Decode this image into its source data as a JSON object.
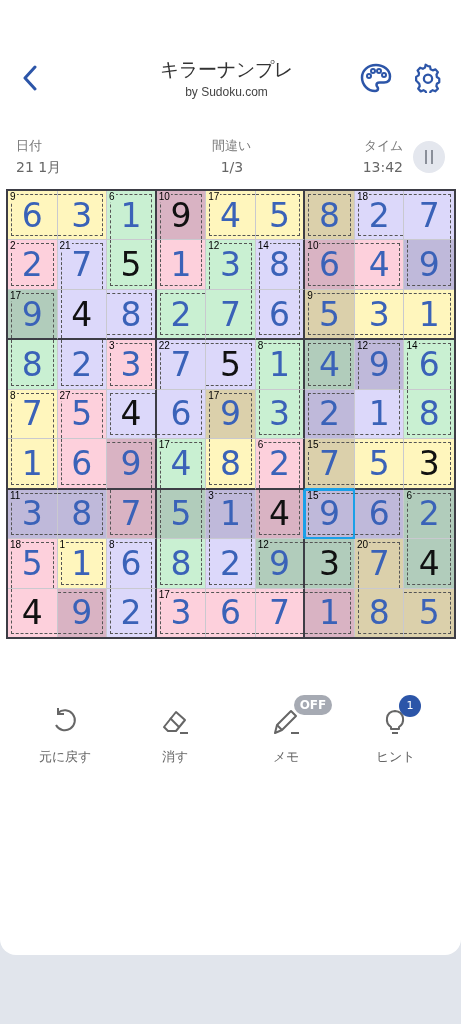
{
  "header": {
    "title": "キラーナンプレ",
    "subtitle": "by Sudoku.com"
  },
  "stats": [
    {
      "label": "日付",
      "value": "21 1月"
    },
    {
      "label": "間違い",
      "value": "1/3"
    },
    {
      "label": "タイム",
      "value": "13:42"
    }
  ],
  "grid": [
    [
      {
        "value": "6",
        "given": false,
        "sum": "9",
        "color": "#fff6bd",
        "cage_edges": [
          true,
          false,
          true,
          true
        ],
        "selected": false
      },
      {
        "value": "3",
        "given": false,
        "color": "#fff6bd",
        "cage_edges": [
          true,
          true,
          true,
          false
        ],
        "selected": false
      },
      {
        "value": "1",
        "given": false,
        "sum": "6",
        "color": "#c9f0d2",
        "cage_edges": [
          true,
          true,
          false,
          true
        ],
        "selected": false
      },
      {
        "value": "9",
        "given": true,
        "sum": "10",
        "color": "#d9b3c3",
        "cage_edges": [
          true,
          true,
          false,
          true
        ],
        "selected": false
      },
      {
        "value": "4",
        "given": false,
        "sum": "17",
        "color": "#fff6bd",
        "cage_edges": [
          true,
          false,
          true,
          true
        ],
        "selected": false
      },
      {
        "value": "5",
        "given": false,
        "color": "#fff6bd",
        "cage_edges": [
          true,
          true,
          true,
          false
        ],
        "selected": false
      },
      {
        "value": "8",
        "given": false,
        "color": "#dbd0ab",
        "cage_edges": [
          true,
          true,
          true,
          true
        ],
        "selected": false
      },
      {
        "value": "2",
        "given": false,
        "sum": "18",
        "color": "#dcd8fa",
        "cage_edges": [
          true,
          false,
          true,
          true
        ],
        "selected": false
      },
      {
        "value": "7",
        "given": false,
        "color": "#dcd8fa",
        "cage_edges": [
          true,
          true,
          false,
          false
        ],
        "selected": false
      }
    ],
    [
      {
        "value": "2",
        "given": false,
        "sum": "2",
        "color": "#fdd0dc",
        "cage_edges": [
          true,
          true,
          true,
          true
        ],
        "selected": false
      },
      {
        "value": "7",
        "given": false,
        "sum": "21",
        "color": "#dcd8fa",
        "cage_edges": [
          true,
          true,
          false,
          true
        ],
        "selected": false
      },
      {
        "value": "5",
        "given": true,
        "color": "#c9f0d2",
        "cage_edges": [
          false,
          true,
          true,
          true
        ],
        "selected": false
      },
      {
        "value": "1",
        "given": false,
        "color": "#fdd0dc",
        "cage_edges": [
          false,
          true,
          true,
          true
        ],
        "selected": false
      },
      {
        "value": "3",
        "given": false,
        "sum": "12",
        "color": "#c9f0d2",
        "cage_edges": [
          true,
          true,
          false,
          true
        ],
        "selected": false
      },
      {
        "value": "8",
        "given": false,
        "sum": "14",
        "color": "#dcd8fa",
        "cage_edges": [
          true,
          true,
          false,
          true
        ],
        "selected": false
      },
      {
        "value": "6",
        "given": false,
        "sum": "10",
        "color": "#d9b3c3",
        "cage_edges": [
          true,
          false,
          true,
          true
        ],
        "selected": false
      },
      {
        "value": "4",
        "given": false,
        "color": "#fdd0dc",
        "cage_edges": [
          true,
          true,
          true,
          false
        ],
        "selected": false
      },
      {
        "value": "9",
        "given": false,
        "color": "#bfb9da",
        "cage_edges": [
          false,
          true,
          true,
          true
        ],
        "selected": false
      }
    ],
    [
      {
        "value": "9",
        "given": false,
        "sum": "17",
        "color": "#b1ccbb",
        "cage_edges": [
          true,
          true,
          false,
          true
        ],
        "selected": false
      },
      {
        "value": "4",
        "given": true,
        "color": "#dcd8fa",
        "cage_edges": [
          false,
          false,
          false,
          true
        ],
        "selected": false
      },
      {
        "value": "8",
        "given": false,
        "color": "#dcd8fa",
        "cage_edges": [
          true,
          true,
          true,
          false
        ],
        "selected": false
      },
      {
        "value": "2",
        "given": false,
        "color": "#c9f0d2",
        "cage_edges": [
          true,
          false,
          true,
          true
        ],
        "selected": false
      },
      {
        "value": "7",
        "given": false,
        "color": "#c9f0d2",
        "cage_edges": [
          false,
          true,
          true,
          false
        ],
        "selected": false
      },
      {
        "value": "6",
        "given": false,
        "color": "#dcd8fa",
        "cage_edges": [
          false,
          true,
          true,
          true
        ],
        "selected": false
      },
      {
        "value": "5",
        "given": false,
        "sum": "9",
        "color": "#dbd0ab",
        "cage_edges": [
          true,
          false,
          true,
          true
        ],
        "selected": false
      },
      {
        "value": "3",
        "given": false,
        "color": "#fff6bd",
        "cage_edges": [
          true,
          false,
          true,
          false
        ],
        "selected": false
      },
      {
        "value": "1",
        "given": false,
        "color": "#fff6bd",
        "cage_edges": [
          true,
          true,
          true,
          false
        ],
        "selected": false
      }
    ],
    [
      {
        "value": "8",
        "given": false,
        "color": "#c9f0d2",
        "cage_edges": [
          false,
          true,
          true,
          true
        ],
        "selected": false
      },
      {
        "value": "2",
        "given": false,
        "color": "#dcd8fa",
        "cage_edges": [
          false,
          true,
          true,
          true
        ],
        "selected": false
      },
      {
        "value": "3",
        "given": false,
        "sum": "3",
        "color": "#fdd0dc",
        "cage_edges": [
          true,
          true,
          true,
          true
        ],
        "selected": false
      },
      {
        "value": "7",
        "given": false,
        "sum": "22",
        "color": "#dcd8fa",
        "cage_edges": [
          true,
          false,
          false,
          true
        ],
        "selected": false
      },
      {
        "value": "5",
        "given": true,
        "color": "#dcd8fa",
        "cage_edges": [
          true,
          true,
          true,
          false
        ],
        "selected": false
      },
      {
        "value": "1",
        "given": false,
        "sum": "8",
        "color": "#c9f0d2",
        "cage_edges": [
          true,
          true,
          false,
          true
        ],
        "selected": false
      },
      {
        "value": "4",
        "given": false,
        "color": "#b1ccbb",
        "cage_edges": [
          true,
          true,
          true,
          true
        ],
        "selected": false
      },
      {
        "value": "9",
        "given": false,
        "sum": "12",
        "color": "#bfb9da",
        "cage_edges": [
          true,
          true,
          false,
          true
        ],
        "selected": false
      },
      {
        "value": "6",
        "given": false,
        "sum": "14",
        "color": "#c9f0d2",
        "cage_edges": [
          true,
          true,
          false,
          true
        ],
        "selected": false
      }
    ],
    [
      {
        "value": "7",
        "given": false,
        "sum": "8",
        "color": "#fff6bd",
        "cage_edges": [
          true,
          true,
          false,
          true
        ],
        "selected": false
      },
      {
        "value": "5",
        "given": false,
        "sum": "27",
        "color": "#fdd0dc",
        "cage_edges": [
          true,
          true,
          false,
          true
        ],
        "selected": false
      },
      {
        "value": "4",
        "given": true,
        "color": "#dcd8fa",
        "cage_edges": [
          true,
          false,
          true,
          true
        ],
        "selected": false
      },
      {
        "value": "6",
        "given": false,
        "color": "#dcd8fa",
        "cage_edges": [
          false,
          true,
          true,
          false
        ],
        "selected": false
      },
      {
        "value": "9",
        "given": false,
        "sum": "17",
        "color": "#dbd0ab",
        "cage_edges": [
          true,
          true,
          false,
          true
        ],
        "selected": false
      },
      {
        "value": "3",
        "given": false,
        "color": "#c9f0d2",
        "cage_edges": [
          false,
          true,
          true,
          true
        ],
        "selected": false
      },
      {
        "value": "2",
        "given": false,
        "color": "#bfb9da",
        "cage_edges": [
          true,
          false,
          true,
          true
        ],
        "selected": false
      },
      {
        "value": "1",
        "given": false,
        "color": "#dcd8fa",
        "cage_edges": [
          false,
          true,
          true,
          false
        ],
        "selected": false
      },
      {
        "value": "8",
        "given": false,
        "color": "#c9f0d2",
        "cage_edges": [
          false,
          true,
          true,
          true
        ],
        "selected": false
      }
    ],
    [
      {
        "value": "1",
        "given": false,
        "color": "#fff6bd",
        "cage_edges": [
          false,
          true,
          true,
          true
        ],
        "selected": false
      },
      {
        "value": "6",
        "given": false,
        "color": "#fdd0dc",
        "cage_edges": [
          false,
          false,
          true,
          true
        ],
        "selected": false
      },
      {
        "value": "9",
        "given": false,
        "color": "#d9b3c3",
        "cage_edges": [
          true,
          true,
          false,
          false
        ],
        "selected": false
      },
      {
        "value": "4",
        "given": false,
        "sum": "17",
        "color": "#c9f0d2",
        "cage_edges": [
          true,
          true,
          false,
          true
        ],
        "selected": false
      },
      {
        "value": "8",
        "given": false,
        "color": "#fff6bd",
        "cage_edges": [
          false,
          true,
          true,
          true
        ],
        "selected": false
      },
      {
        "value": "2",
        "given": false,
        "sum": "6",
        "color": "#fdd0dc",
        "cage_edges": [
          true,
          true,
          false,
          true
        ],
        "selected": false
      },
      {
        "value": "7",
        "given": false,
        "sum": "15",
        "color": "#dbd0ab",
        "cage_edges": [
          true,
          false,
          true,
          true
        ],
        "selected": false
      },
      {
        "value": "5",
        "given": false,
        "color": "#fff6bd",
        "cage_edges": [
          true,
          false,
          true,
          false
        ],
        "selected": false
      },
      {
        "value": "3",
        "given": true,
        "color": "#fff6bd",
        "cage_edges": [
          true,
          true,
          true,
          false
        ],
        "selected": false
      }
    ],
    [
      {
        "value": "3",
        "given": false,
        "sum": "11",
        "color": "#bfb9da",
        "cage_edges": [
          true,
          false,
          true,
          true
        ],
        "selected": false
      },
      {
        "value": "8",
        "given": false,
        "color": "#bfb9da",
        "cage_edges": [
          true,
          true,
          true,
          false
        ],
        "selected": false
      },
      {
        "value": "7",
        "given": false,
        "color": "#d9b3c3",
        "cage_edges": [
          false,
          true,
          true,
          true
        ],
        "selected": false
      },
      {
        "value": "5",
        "given": false,
        "color": "#b1ccbb",
        "cage_edges": [
          false,
          true,
          false,
          true
        ],
        "selected": false
      },
      {
        "value": "1",
        "given": false,
        "sum": "3",
        "color": "#bfb9da",
        "cage_edges": [
          true,
          true,
          false,
          true
        ],
        "selected": false
      },
      {
        "value": "4",
        "given": true,
        "color": "#d9b3c3",
        "cage_edges": [
          false,
          true,
          true,
          true
        ],
        "selected": false
      },
      {
        "value": "9",
        "given": false,
        "sum": "15",
        "color": "#bfb9da",
        "cage_edges": [
          true,
          false,
          true,
          true
        ],
        "selected": true
      },
      {
        "value": "6",
        "given": false,
        "color": "#bfb9da",
        "cage_edges": [
          true,
          true,
          true,
          false
        ],
        "selected": false
      },
      {
        "value": "2",
        "given": false,
        "sum": "6",
        "color": "#b1ccbb",
        "cage_edges": [
          true,
          true,
          false,
          true
        ],
        "selected": false
      }
    ],
    [
      {
        "value": "5",
        "given": false,
        "sum": "18",
        "color": "#fdd0dc",
        "cage_edges": [
          true,
          true,
          false,
          true
        ],
        "selected": false
      },
      {
        "value": "1",
        "given": false,
        "sum": "1",
        "color": "#fff6bd",
        "cage_edges": [
          true,
          true,
          true,
          true
        ],
        "selected": false
      },
      {
        "value": "6",
        "given": false,
        "sum": "8",
        "color": "#dcd8fa",
        "cage_edges": [
          true,
          true,
          false,
          true
        ],
        "selected": false
      },
      {
        "value": "8",
        "given": false,
        "color": "#c9f0d2",
        "cage_edges": [
          false,
          true,
          true,
          true
        ],
        "selected": false
      },
      {
        "value": "2",
        "given": false,
        "color": "#dcd8fa",
        "cage_edges": [
          false,
          true,
          true,
          true
        ],
        "selected": false
      },
      {
        "value": "9",
        "given": false,
        "sum": "12",
        "color": "#b1ccbb",
        "cage_edges": [
          true,
          false,
          true,
          true
        ],
        "selected": false
      },
      {
        "value": "3",
        "given": true,
        "color": "#b1ccbb",
        "cage_edges": [
          true,
          true,
          true,
          false
        ],
        "selected": false
      },
      {
        "value": "7",
        "given": false,
        "sum": "20",
        "color": "#dbd0ab",
        "cage_edges": [
          true,
          true,
          false,
          true
        ],
        "selected": false
      },
      {
        "value": "4",
        "given": true,
        "color": "#b1ccbb",
        "cage_edges": [
          false,
          true,
          true,
          true
        ],
        "selected": false
      }
    ],
    [
      {
        "value": "4",
        "given": true,
        "color": "#fdd0dc",
        "cage_edges": [
          false,
          false,
          true,
          true
        ],
        "selected": false
      },
      {
        "value": "9",
        "given": false,
        "color": "#d9b3c3",
        "cage_edges": [
          true,
          true,
          true,
          false
        ],
        "selected": false
      },
      {
        "value": "2",
        "given": false,
        "color": "#dcd8fa",
        "cage_edges": [
          false,
          true,
          true,
          true
        ],
        "selected": false
      },
      {
        "value": "3",
        "given": false,
        "sum": "17",
        "color": "#fdd0dc",
        "cage_edges": [
          true,
          false,
          true,
          true
        ],
        "selected": false
      },
      {
        "value": "6",
        "given": false,
        "color": "#fdd0dc",
        "cage_edges": [
          true,
          false,
          true,
          false
        ],
        "selected": false
      },
      {
        "value": "7",
        "given": false,
        "color": "#fdd0dc",
        "cage_edges": [
          true,
          false,
          true,
          false
        ],
        "selected": false
      },
      {
        "value": "1",
        "given": false,
        "color": "#d9b3c3",
        "cage_edges": [
          true,
          true,
          true,
          false
        ],
        "selected": false
      },
      {
        "value": "8",
        "given": false,
        "color": "#dbd0ab",
        "cage_edges": [
          false,
          false,
          true,
          true
        ],
        "selected": false
      },
      {
        "value": "5",
        "given": false,
        "color": "#dbd0ab",
        "cage_edges": [
          true,
          true,
          true,
          false
        ],
        "selected": false
      }
    ]
  ],
  "tools": [
    {
      "kind": "undo",
      "label": "元に戻す"
    },
    {
      "kind": "erase",
      "label": "消す"
    },
    {
      "kind": "notes",
      "label": "メモ",
      "badge": "OFF"
    },
    {
      "kind": "hint",
      "label": "ヒント",
      "badge": "1"
    }
  ]
}
